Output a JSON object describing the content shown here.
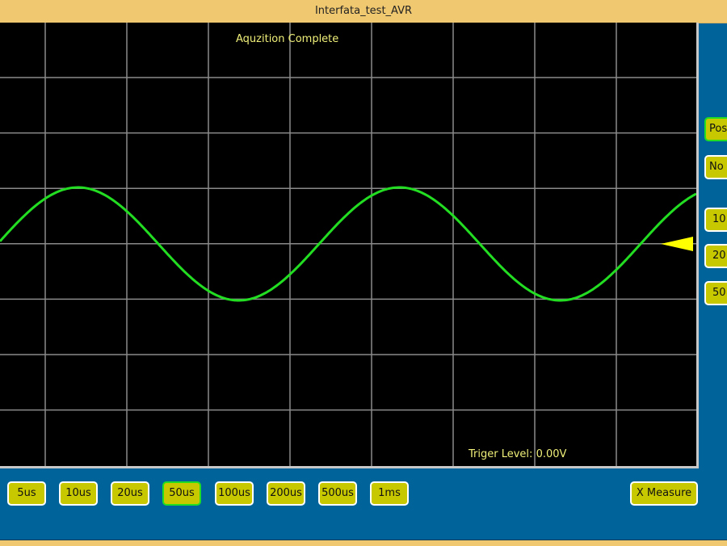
{
  "window": {
    "title": "Interfata_test_AVR"
  },
  "scope": {
    "status": "Aquzition Complete",
    "trigger_level_label": "Triger Level:",
    "trigger_level_value": "0.00V",
    "trace_color": "#22dd22",
    "grid_color": "#8a8a8a",
    "trigger_marker_color": "#ffff00",
    "waveform": "sine"
  },
  "side_buttons": [
    {
      "label": "Pos",
      "selected": true
    },
    {
      "label": "No",
      "selected": false
    },
    {
      "label": "10",
      "selected": false
    },
    {
      "label": "20",
      "selected": false
    },
    {
      "label": "50",
      "selected": false
    }
  ],
  "timebase_buttons": [
    {
      "label": "5us",
      "selected": false
    },
    {
      "label": "10us",
      "selected": false
    },
    {
      "label": "20us",
      "selected": false
    },
    {
      "label": "50us",
      "selected": true
    },
    {
      "label": "100us",
      "selected": false
    },
    {
      "label": "200us",
      "selected": false
    },
    {
      "label": "500us",
      "selected": false
    },
    {
      "label": "1ms",
      "selected": false
    }
  ],
  "measure_button": {
    "label": "X Measure"
  }
}
